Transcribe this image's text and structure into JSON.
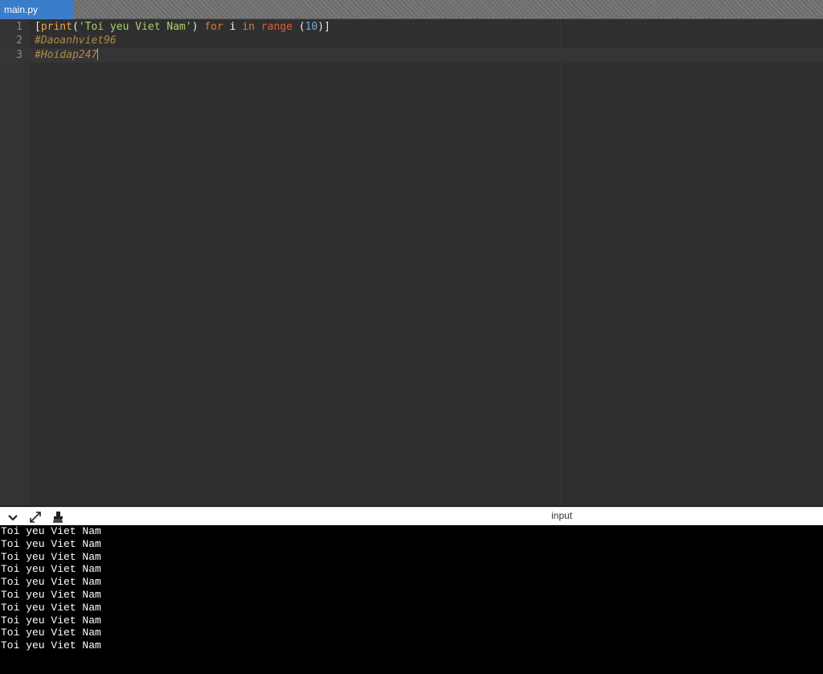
{
  "tab": {
    "label": "main.py"
  },
  "editor": {
    "lines": [
      {
        "number": "1"
      },
      {
        "number": "2",
        "text": "#Daoanhviet96"
      },
      {
        "number": "3",
        "text": "#Hoidap247"
      }
    ],
    "line1": {
      "open_bracket": "[",
      "func": "print",
      "paren_open": "(",
      "string": "'Toi yeu Viet Nam'",
      "paren_close": ")",
      "kw_for": "for",
      "var": "i",
      "kw_in": "in",
      "builtin": "range",
      "paren2_open": "(",
      "number": "10",
      "paren2_close": ")]"
    }
  },
  "console": {
    "title": "input",
    "buttons": [
      "chevron-down-icon",
      "expand-icon",
      "clear-console-icon"
    ],
    "output": [
      "Toi yeu Viet Nam",
      "Toi yeu Viet Nam",
      "Toi yeu Viet Nam",
      "Toi yeu Viet Nam",
      "Toi yeu Viet Nam",
      "Toi yeu Viet Nam",
      "Toi yeu Viet Nam",
      "Toi yeu Viet Nam",
      "Toi yeu Viet Nam",
      "Toi yeu Viet Nam"
    ]
  }
}
